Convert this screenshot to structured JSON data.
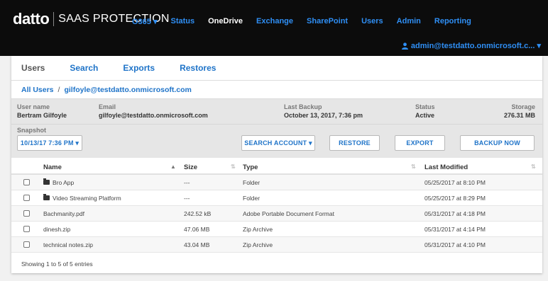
{
  "brand": {
    "logo": "datto",
    "product": "SAAS PROTECTION"
  },
  "nav": {
    "items": [
      {
        "label": "O365 ▾",
        "active": false
      },
      {
        "label": "Status",
        "active": false
      },
      {
        "label": "OneDrive",
        "active": true
      },
      {
        "label": "Exchange",
        "active": false
      },
      {
        "label": "SharePoint",
        "active": false
      },
      {
        "label": "Users",
        "active": false
      },
      {
        "label": "Admin",
        "active": false
      },
      {
        "label": "Reporting",
        "active": false
      }
    ]
  },
  "user_menu": {
    "label": "admin@testdatto.onmicrosoft.c... ▾"
  },
  "tabs": {
    "users": "Users",
    "search": "Search",
    "exports": "Exports",
    "restores": "Restores"
  },
  "breadcrumb": {
    "root": "All Users",
    "separator": "/",
    "current": "gilfoyle@testdatto.onmicrosoft.com"
  },
  "account": {
    "username_label": "User name",
    "username": "Bertram Gilfoyle",
    "email_label": "Email",
    "email": "gilfoyle@testdatto.onmicrosoft.com",
    "last_backup_label": "Last Backup",
    "last_backup": "October 13, 2017, 7:36 pm",
    "status_label": "Status",
    "status": "Active",
    "storage_label": "Storage",
    "storage": "276.31 MB"
  },
  "snapshot": {
    "label": "Snapshot",
    "value": "10/13/17 7:36 PM ▾"
  },
  "actions": {
    "search_account": "SEARCH ACCOUNT ▾",
    "restore": "RESTORE",
    "export": "EXPORT",
    "backup_now": "BACKUP NOW"
  },
  "table": {
    "headers": {
      "name": "Name",
      "size": "Size",
      "type": "Type",
      "last_modified": "Last Modified"
    },
    "rows": [
      {
        "name": "Bro App",
        "folder": true,
        "size": "---",
        "type": "Folder",
        "modified": "05/25/2017 at 8:10 PM"
      },
      {
        "name": "Video Streaming Platform",
        "folder": true,
        "size": "---",
        "type": "Folder",
        "modified": "05/25/2017 at 8:29 PM"
      },
      {
        "name": "Bachmanity.pdf",
        "folder": false,
        "size": "242.52 kB",
        "type": "Adobe Portable Document Format",
        "modified": "05/31/2017 at 4:18 PM"
      },
      {
        "name": "dinesh.zip",
        "folder": false,
        "size": "47.06 MB",
        "type": "Zip Archive",
        "modified": "05/31/2017 at 4:14 PM"
      },
      {
        "name": "technical notes.zip",
        "folder": false,
        "size": "43.04 MB",
        "type": "Zip Archive",
        "modified": "05/31/2017 at 4:10 PM"
      }
    ],
    "footer": "Showing 1 to 5 of 5 entries"
  },
  "colors": {
    "topbar": "#0c0c0c",
    "link": "#1e73c8",
    "nav_link": "#2f8ff5",
    "info_bg": "#e6e6e6"
  }
}
